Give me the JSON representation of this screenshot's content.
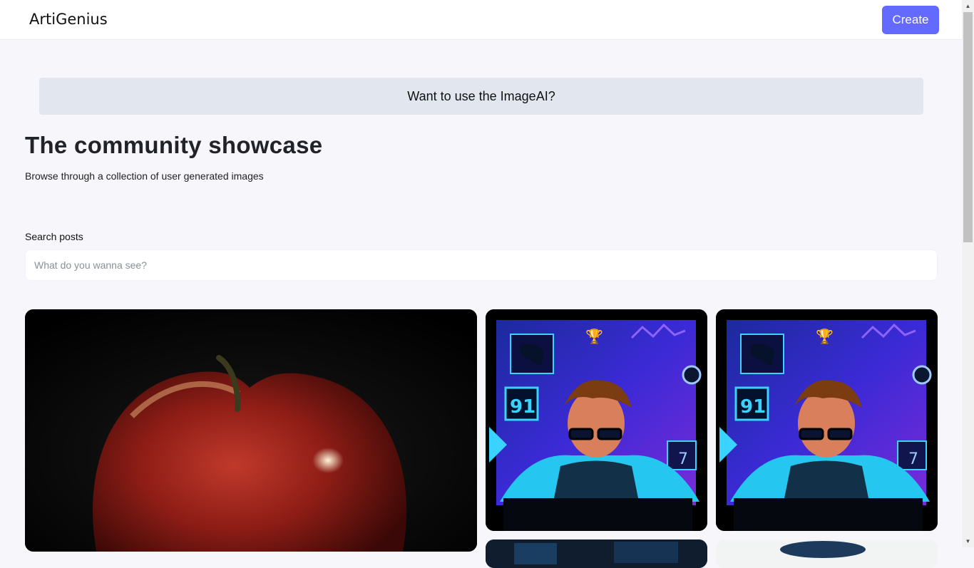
{
  "header": {
    "logo_text": "ArtiGenius",
    "create_label": "Create"
  },
  "banner": {
    "text": "Want to use the ImageAI?"
  },
  "hero": {
    "title": "The community showcase",
    "subtitle": "Browse through a collection of user generated images"
  },
  "search": {
    "label": "Search posts",
    "placeholder": "What do you wanna see?",
    "value": ""
  },
  "gallery": {
    "cards": [
      {
        "subject": "red apple photo"
      },
      {
        "subject": "cyberpunk coder illustration"
      },
      {
        "subject": "cyberpunk coder illustration"
      },
      {
        "subject": "blue scene image"
      },
      {
        "subject": "pale scene image"
      }
    ]
  },
  "colors": {
    "accent": "#6469ff",
    "background": "#f6f6fb",
    "banner": "#e2e7ef"
  }
}
